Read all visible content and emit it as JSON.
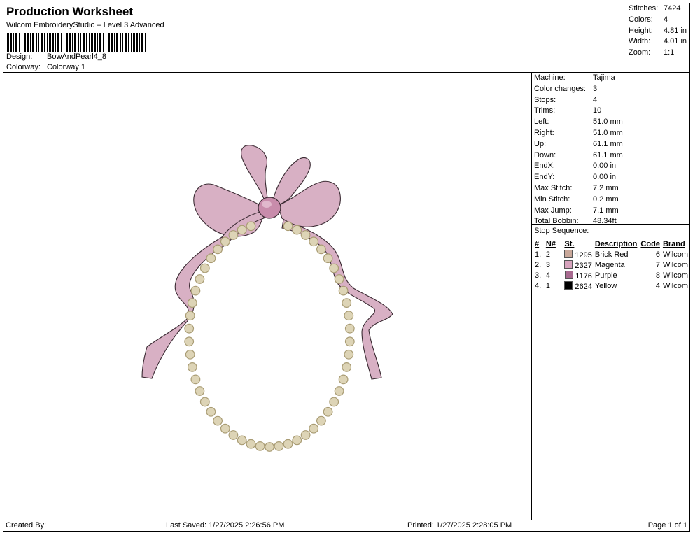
{
  "header": {
    "title": "Production Worksheet",
    "subtitle": "Wilcom EmbroideryStudio – Level 3 Advanced",
    "design_label": "Design:",
    "design_value": "BowAndPearl4_8",
    "colorway_label": "Colorway:",
    "colorway_value": "Colorway 1"
  },
  "stats": [
    {
      "label": "Stitches:",
      "value": "7424"
    },
    {
      "label": "Colors:",
      "value": "4"
    },
    {
      "label": "Height:",
      "value": "4.81 in"
    },
    {
      "label": "Width:",
      "value": "4.01 in"
    },
    {
      "label": "Zoom:",
      "value": "1:1"
    }
  ],
  "specs": [
    {
      "label": "Machine:",
      "value": "Tajima"
    },
    {
      "label": "Color changes:",
      "value": "3"
    },
    {
      "label": "Stops:",
      "value": "4"
    },
    {
      "label": "Trims:",
      "value": "10"
    },
    {
      "label": "Left:",
      "value": "51.0 mm"
    },
    {
      "label": "Right:",
      "value": "51.0 mm"
    },
    {
      "label": "Up:",
      "value": "61.1 mm"
    },
    {
      "label": "Down:",
      "value": "61.1 mm"
    },
    {
      "label": "EndX:",
      "value": "0.00 in"
    },
    {
      "label": "EndY:",
      "value": "0.00 in"
    },
    {
      "label": "Max Stitch:",
      "value": "7.2 mm"
    },
    {
      "label": "Min Stitch:",
      "value": "0.2 mm"
    },
    {
      "label": "Max Jump:",
      "value": "7.1 mm"
    },
    {
      "label": "Total Bobbin:",
      "value": "48.34ft"
    }
  ],
  "stop_sequence": {
    "title": "Stop Sequence:",
    "headers": [
      "#",
      "N#",
      "St.",
      "Description",
      "Code",
      "Brand"
    ],
    "rows": [
      {
        "num": "1.",
        "n": "2",
        "color": "#c9a89a",
        "st": "1295",
        "desc": "Brick Red",
        "code": "6",
        "brand": "Wilcom"
      },
      {
        "num": "2.",
        "n": "3",
        "color": "#d7a3bd",
        "st": "2327",
        "desc": "Magenta",
        "code": "7",
        "brand": "Wilcom"
      },
      {
        "num": "3.",
        "n": "4",
        "color": "#a86a90",
        "st": "1176",
        "desc": "Purple",
        "code": "8",
        "brand": "Wilcom"
      },
      {
        "num": "4.",
        "n": "1",
        "color": "#000000",
        "st": "2624",
        "desc": "Yellow",
        "code": "4",
        "brand": "Wilcom"
      }
    ]
  },
  "footer": {
    "created_by": "Created By:",
    "last_saved": "Last Saved: 1/27/2025 2:26:56 PM",
    "printed": "Printed: 1/27/2025 2:28:05 PM",
    "page": "Page 1 of 1"
  },
  "colors": {
    "ribbon_fill": "#d8b0c4",
    "ribbon_shade": "#b7809c",
    "ribbon_outline": "#3a2a32",
    "pearl_fill": "#ddd4b6",
    "pearl_shade": "#a99c74"
  }
}
